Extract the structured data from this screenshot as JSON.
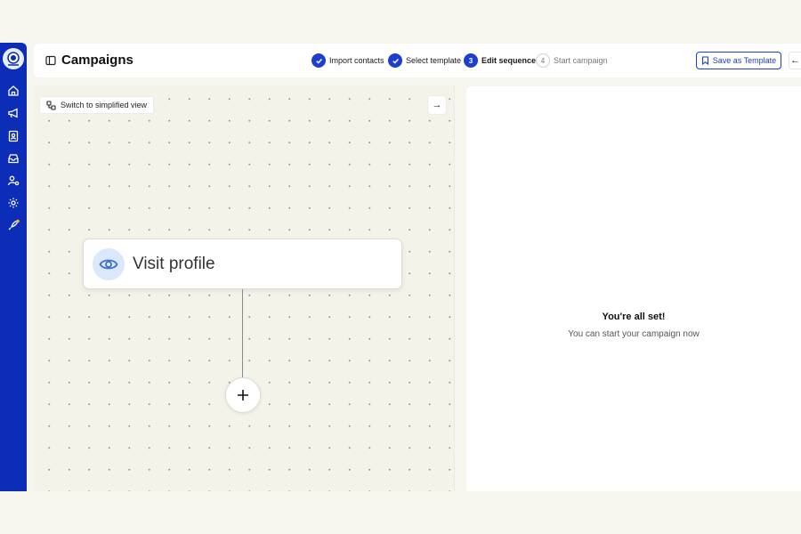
{
  "sidebar": {
    "logo": "astronaut-logo",
    "items": [
      {
        "icon": "home-icon"
      },
      {
        "icon": "megaphone-icon"
      },
      {
        "icon": "contacts-book-icon"
      },
      {
        "icon": "inbox-icon"
      },
      {
        "icon": "user-settings-icon"
      },
      {
        "icon": "gear-icon"
      },
      {
        "icon": "rocket-icon"
      }
    ]
  },
  "header": {
    "title": "Campaigns",
    "steps": [
      {
        "number": "1",
        "label": "Import contacts",
        "status": "done"
      },
      {
        "number": "2",
        "label": "Select template",
        "status": "done"
      },
      {
        "number": "3",
        "label": "Edit sequence",
        "status": "active"
      },
      {
        "number": "4",
        "label": "Start campaign",
        "status": "todo"
      }
    ],
    "save_label": "Save as Template",
    "back_glyph": "←"
  },
  "canvas": {
    "simplify_label": "Switch to simplified view",
    "expand_glyph": "→",
    "node_label": "Visit profile",
    "add_glyph": "+"
  },
  "panel": {
    "title": "You're all set!",
    "subtitle": "You can start your campaign now"
  },
  "colors": {
    "brand": "#0b2db8",
    "accent": "#1c3fcf",
    "background": "#f6f5ee",
    "node_icon_bg": "#dbe7fb"
  }
}
